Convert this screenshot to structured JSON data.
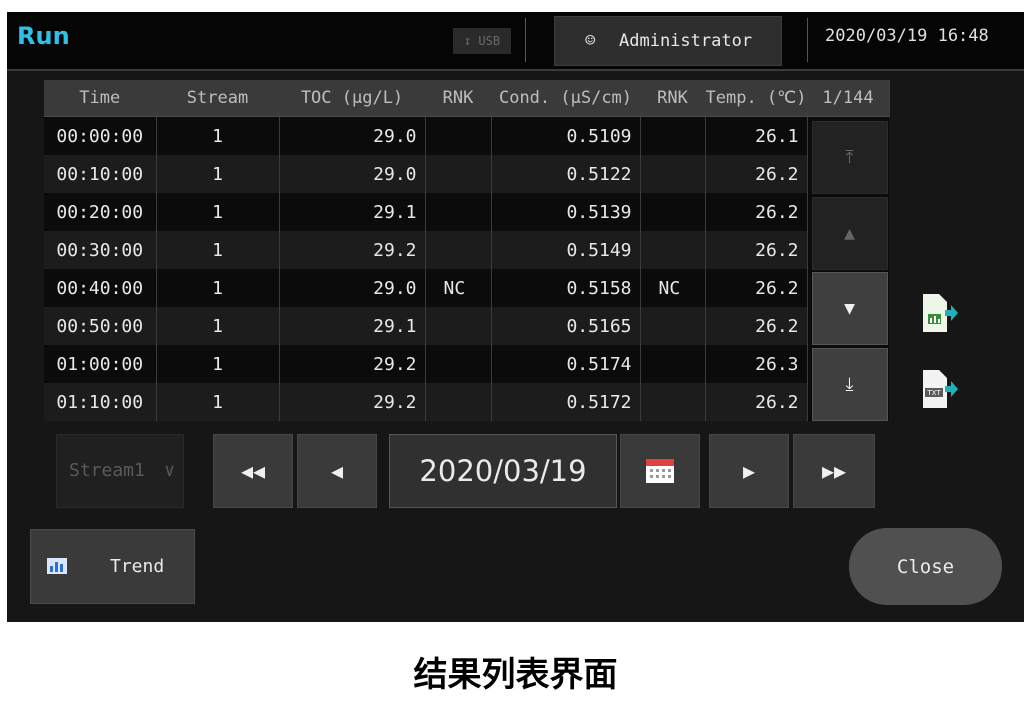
{
  "window": {
    "title": "Run",
    "usb_label": "USB",
    "user_label": "Administrator",
    "datetime": "2020/03/19 16:48"
  },
  "table": {
    "columns": [
      "Time",
      "Stream",
      "TOC (µg/L)",
      "RNK",
      "Cond. (µS/cm)",
      "RNK",
      "Temp. (℃)"
    ],
    "page_indicator": "1/144",
    "rows": [
      [
        "00:00:00",
        "1",
        "29.0",
        "",
        "0.5109",
        "",
        "26.1"
      ],
      [
        "00:10:00",
        "1",
        "29.0",
        "",
        "0.5122",
        "",
        "26.2"
      ],
      [
        "00:20:00",
        "1",
        "29.1",
        "",
        "0.5139",
        "",
        "26.2"
      ],
      [
        "00:30:00",
        "1",
        "29.2",
        "",
        "0.5149",
        "",
        "26.2"
      ],
      [
        "00:40:00",
        "1",
        "29.0",
        "NC",
        "0.5158",
        "NC",
        "26.2"
      ],
      [
        "00:50:00",
        "1",
        "29.1",
        "",
        "0.5165",
        "",
        "26.2"
      ],
      [
        "01:00:00",
        "1",
        "29.2",
        "",
        "0.5174",
        "",
        "26.3"
      ],
      [
        "01:10:00",
        "1",
        "29.2",
        "",
        "0.5172",
        "",
        "26.2"
      ]
    ]
  },
  "controls": {
    "stream_select": "Stream1",
    "date": "2020/03/19",
    "trend_label": "Trend",
    "close_label": "Close"
  },
  "icons": {
    "user": "user-icon",
    "usb": "usb-icon",
    "first": "scroll-to-top-icon",
    "up": "scroll-up-icon",
    "down": "scroll-down-icon",
    "last": "scroll-to-bottom-icon",
    "calendar": "calendar-icon",
    "csv_export": "csv-export-icon",
    "txt_export": "txt-export-icon",
    "trend": "bar-chart-icon"
  },
  "colors": {
    "title": "#2ec0e6",
    "background": "#161616",
    "calendar_accent": "#e04040",
    "export_arrow": "#20b0b8"
  },
  "caption": "结果列表界面"
}
